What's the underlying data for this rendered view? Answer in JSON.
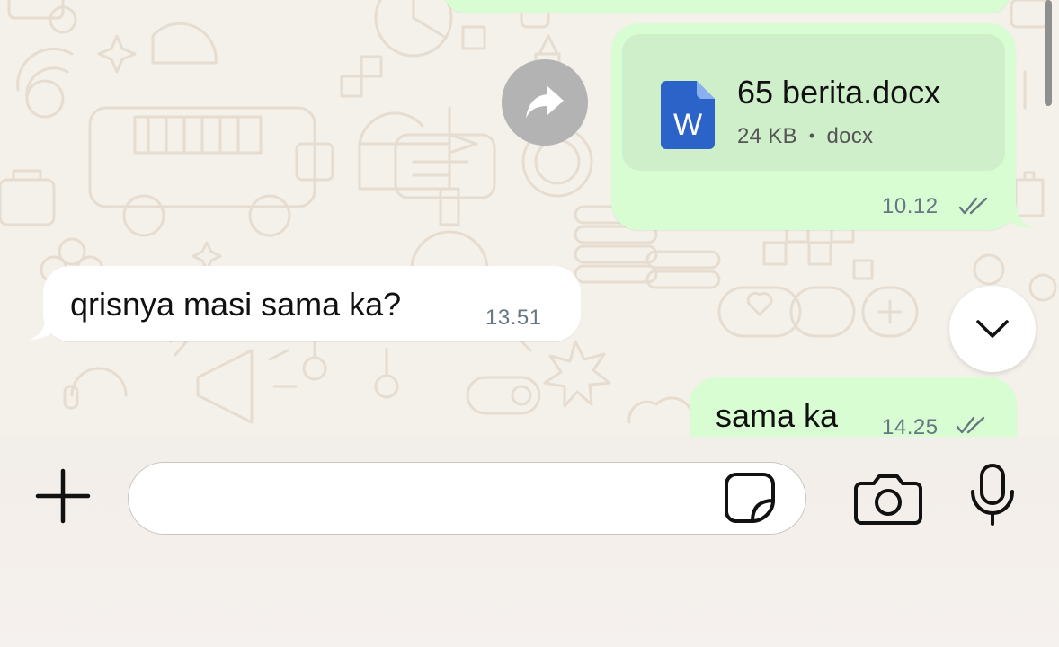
{
  "messages": {
    "file": {
      "name": "65 berita.docx",
      "size": "24 KB",
      "separator": "•",
      "type": "docx",
      "icon_letter": "W",
      "time": "10.12",
      "status": "read"
    },
    "incoming": {
      "text": "qrisnya masi sama ka?",
      "time": "13.51"
    },
    "outgoing": {
      "text": "sama ka",
      "time": "14.25",
      "status": "read"
    }
  },
  "composer": {
    "placeholder": "",
    "value": ""
  },
  "icons": {
    "forward": "forward-arrow-icon",
    "scroll_down": "chevron-down-icon",
    "plus": "plus-icon",
    "sticker": "sticker-icon",
    "camera": "camera-icon",
    "mic": "microphone-icon",
    "double_check": "double-check-icon",
    "doc": "word-document-icon"
  },
  "colors": {
    "outgoing_bubble": "#d9fdd3",
    "file_card": "#cfeeca",
    "incoming_bubble": "#ffffff",
    "word_blue": "#2b63c9",
    "wallpaper": "#f4f0ea"
  }
}
